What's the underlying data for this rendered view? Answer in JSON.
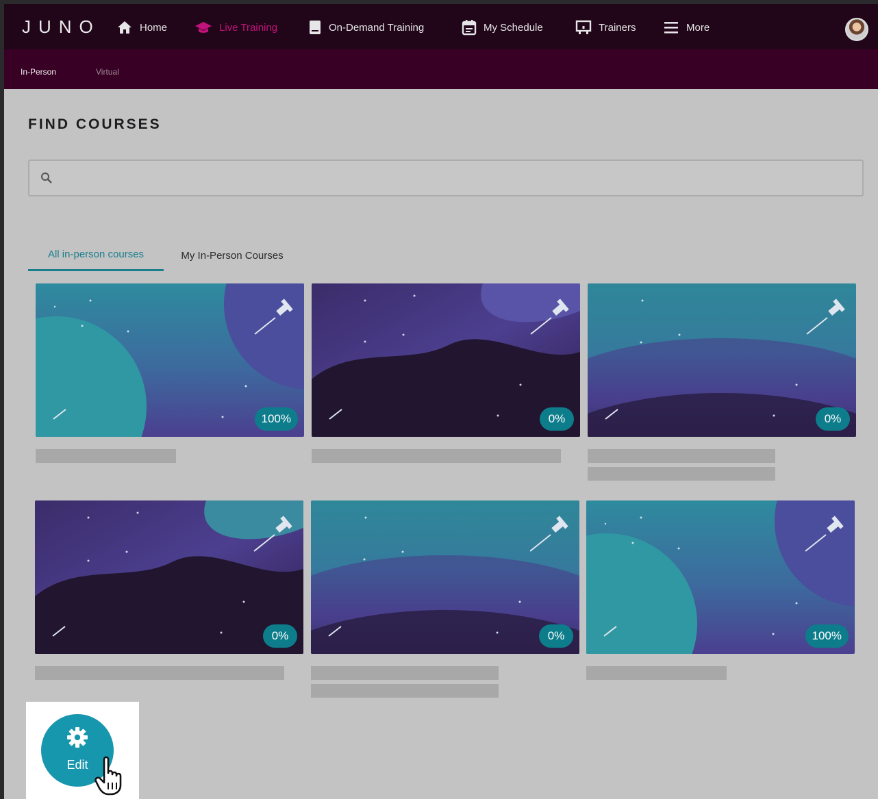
{
  "app": {
    "logo_text": "JUNO"
  },
  "topnav": {
    "items": [
      {
        "label": "Home",
        "icon": "home-icon"
      },
      {
        "label": "Live Training",
        "icon": "graduation-cap-icon",
        "active": true
      },
      {
        "label": "On-Demand Training",
        "icon": "book-icon"
      },
      {
        "label": "My Schedule",
        "icon": "calendar-icon"
      },
      {
        "label": "Trainers",
        "icon": "presentation-board-icon"
      },
      {
        "label": "More",
        "icon": "hamburger-menu-icon"
      }
    ],
    "avatar": "user-avatar"
  },
  "subnav": {
    "items": [
      {
        "label": "In-Person",
        "active": true
      },
      {
        "label": "Virtual",
        "active": false
      }
    ]
  },
  "main": {
    "title": "FIND COURSES",
    "search": {
      "placeholder": "",
      "value": "",
      "icon": "search-icon"
    },
    "tabs": [
      {
        "label": "All in-person courses",
        "active": true
      },
      {
        "label": "My In-Person Courses",
        "active": false
      }
    ],
    "courses": [
      {
        "progress": "100%"
      },
      {
        "progress": "0%"
      },
      {
        "progress": "0%"
      },
      {
        "progress": "0%"
      },
      {
        "progress": "0%"
      },
      {
        "progress": "100%"
      }
    ]
  },
  "edit_button": {
    "label": "Edit",
    "icon": "gear-icon"
  },
  "colors": {
    "nav_bg": "#200618",
    "subnav_bg": "#380024",
    "active_nav": "#c2127c",
    "accent_teal": "#1a7f8c",
    "badge_bg": "#0d7d8c",
    "edit_bg": "#1797ad"
  }
}
